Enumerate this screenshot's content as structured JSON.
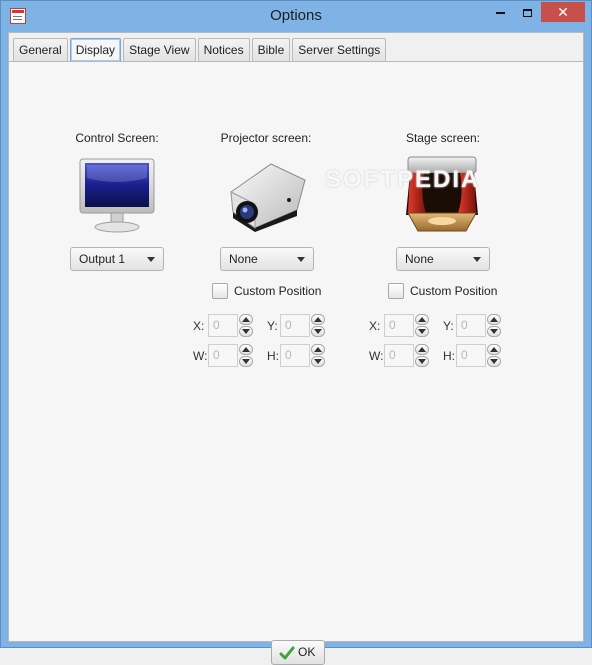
{
  "window": {
    "title": "Options",
    "minimize_glyph": "",
    "close_glyph": "✕"
  },
  "tabs": [
    {
      "label": "General",
      "active": false
    },
    {
      "label": "Display",
      "active": true
    },
    {
      "label": "Stage View",
      "active": false
    },
    {
      "label": "Notices",
      "active": false
    },
    {
      "label": "Bible",
      "active": false
    },
    {
      "label": "Server Settings",
      "active": false
    }
  ],
  "display": {
    "control": {
      "label": "Control Screen:",
      "icon": "monitor-icon",
      "selected": "Output 1"
    },
    "projector": {
      "label": "Projector screen:",
      "icon": "projector-icon",
      "selected": "None",
      "custom_position_label": "Custom Position",
      "custom_position_checked": false,
      "coords": {
        "x": {
          "label": "X:",
          "value": "0"
        },
        "y": {
          "label": "Y:",
          "value": "0"
        },
        "w": {
          "label": "W:",
          "value": "0"
        },
        "h": {
          "label": "H:",
          "value": "0"
        }
      }
    },
    "stage": {
      "label": "Stage screen:",
      "icon": "stage-icon",
      "selected": "None",
      "custom_position_label": "Custom Position",
      "custom_position_checked": false,
      "coords": {
        "x": {
          "label": "X:",
          "value": "0"
        },
        "y": {
          "label": "Y:",
          "value": "0"
        },
        "w": {
          "label": "W:",
          "value": "0"
        },
        "h": {
          "label": "H:",
          "value": "0"
        }
      }
    }
  },
  "watermark": "SOFTPEDIA",
  "footer": {
    "ok_label": "OK"
  },
  "colors": {
    "titlebar": "#7fb3e6",
    "close_button": "#c7504a",
    "ok_check": "#3fa33a"
  }
}
